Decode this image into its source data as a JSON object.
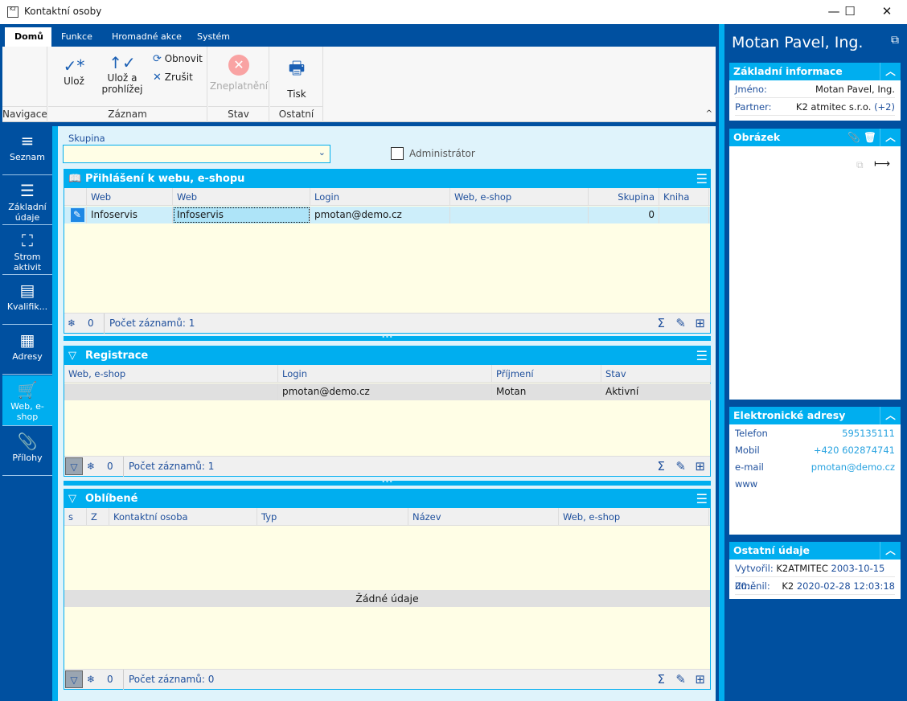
{
  "window": {
    "title": "Kontaktní osoby",
    "logo": "K2",
    "minimize": "—",
    "maximize": "☐",
    "close": "✕"
  },
  "ribbon": {
    "tabs": [
      "Domů",
      "Funkce",
      "Hromadné akce",
      "Systém"
    ],
    "groups": {
      "navigace": "Navigace",
      "zaznam": "Záznam",
      "stav": "Stav",
      "ostatni": "Ostatní"
    },
    "buttons": {
      "uloz": "Ulož",
      "uloz_prohlizej_1": "Ulož a",
      "uloz_prohlizej_2": "prohlížej",
      "obnovit": "Obnovit",
      "zrusit": "Zrušit",
      "zneplatneni": "Zneplatnění",
      "tisk": "Tisk"
    }
  },
  "nav": [
    {
      "label": "Seznam",
      "icon": "≡"
    },
    {
      "label": "Základní údaje",
      "icon": "☰"
    },
    {
      "label": "Strom aktivit",
      "icon": "⛶"
    },
    {
      "label": "Kvalifik...",
      "icon": "▤"
    },
    {
      "label": "Adresy",
      "icon": "▦"
    },
    {
      "label": "Web, e-shop",
      "icon": "🛒",
      "active": true
    },
    {
      "label": "Přílohy",
      "icon": "📎"
    }
  ],
  "form": {
    "skupina_label": "Skupina",
    "skupina_value": "",
    "administrator_label": "Administrátor",
    "administrator_checked": false
  },
  "panels": [
    {
      "title": "Přihlášení k webu, e-shopu",
      "icon": "📖",
      "columns": [
        "",
        "Web",
        "Web",
        "Login",
        "Web, e-shop",
        "Skupina",
        "Kniha"
      ],
      "rows": [
        [
          "✎",
          "Infoservis",
          "Infoservis",
          "pmotan@demo.cz",
          "",
          "0",
          ""
        ]
      ],
      "footer": {
        "marked": "0",
        "count": "Počet záznamů: 1"
      }
    },
    {
      "title": "Registrace",
      "icon": "▽",
      "columns": [
        "Web, e-shop",
        "Login",
        "Příjmení",
        "Stav"
      ],
      "rows": [
        [
          "",
          "pmotan@demo.cz",
          "Motan",
          "Aktivní"
        ]
      ],
      "footer": {
        "marked": "0",
        "count": "Počet záznamů: 1"
      }
    },
    {
      "title": "Oblíbené",
      "icon": "▽",
      "columns": [
        "s",
        "Z",
        "Kontaktní osoba",
        "Typ",
        "Název",
        "Web, e-shop"
      ],
      "rows": [],
      "empty": "Žádné údaje",
      "footer": {
        "marked": "0",
        "count": "Počet záznamů: 0"
      }
    }
  ],
  "right": {
    "name": "Motan Pavel, Ing.",
    "zakladni": {
      "title": "Základní informace",
      "jmeno_label": "Jméno:",
      "jmeno": "Motan Pavel, Ing.",
      "partner_label": "Partner:",
      "partner": "K2 atmitec s.r.o.",
      "partner_extra": "(+2)"
    },
    "obrazek": {
      "title": "Obrázek"
    },
    "elektronicke": {
      "title": "Elektronické adresy",
      "items": [
        {
          "label": "Telefon",
          "value": "595135111"
        },
        {
          "label": "Mobil",
          "value": "+420 602874741"
        },
        {
          "label": "e-mail",
          "value": "pmotan@demo.cz"
        },
        {
          "label": "www",
          "value": ""
        }
      ]
    },
    "ostatni": {
      "title": "Ostatní údaje",
      "vytvoril_label": "Vytvořil:",
      "vytvoril_user": "K2ATMITEC",
      "vytvoril_date": "2003-10-15 00:...",
      "zmenil_label": "Změnil:",
      "zmenil_user": "K2",
      "zmenil_date": "2020-02-28 12:03:18"
    }
  },
  "colors": {
    "dark_blue": "#0050a0",
    "accent": "#00aeef",
    "grid_bg": "#fffee6"
  }
}
